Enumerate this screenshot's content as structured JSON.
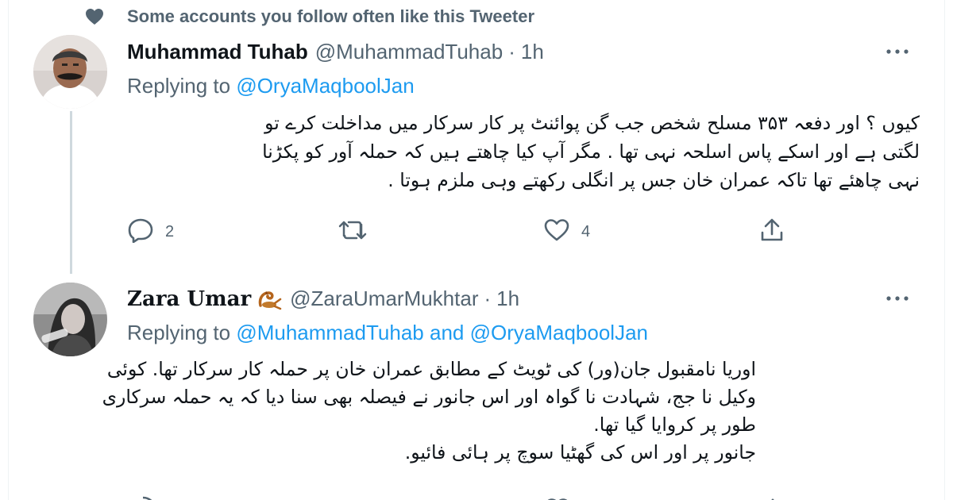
{
  "social_context": {
    "text": "Some accounts you follow often like this Tweeter",
    "icon": "heart-icon"
  },
  "tweets": [
    {
      "display_name": "Muhammad Tuhab",
      "handle": "@MuhammadTuhab",
      "separator": "·",
      "time": "1h",
      "replying_prefix": "Replying to",
      "mention_1": "@OryaMaqboolJan",
      "mention_joiner": "",
      "mention_2": "",
      "body_lines": [
        "کیوں ؟ اور دفعہ ۳۵۳ مسلح شخص جب گن پوائنٹ پر کار سرکار میں مداخلت کرے تو",
        "لگتی ہے اور اسکے پاس اسلحہ نہی تھا . مگر آپ کیا چاھتے ہیں کہ حملہ آور کو پکڑنا",
        "نہی چاھئے تھا تاکہ عمران خان جس پر انگلی رکھتے وہی ملزم ہوتا ."
      ],
      "reply_count": "2",
      "retweet_count": "",
      "like_count": "4"
    },
    {
      "display_name": "𝐙𝐚𝐫𝐚 𝐔𝐦𝐚𝐫",
      "handle": "@ZaraUmarMukhtar",
      "separator": "·",
      "time": "1h",
      "replying_prefix": "Replying to",
      "mention_1": "@MuhammadTuhab",
      "mention_joiner": "and",
      "mention_2": "@OryaMaqboolJan",
      "body_lines": [
        "اوریا نامقبول جان(ور) کی ٹویٹ کے مطابق عمران خان پر حملہ کار سرکار تھا. کوئی",
        "وکیل نا جج،  شہادت نا گواہ اور اس جانور نے فیصلہ بھی سنا دیا کہ یہ حملہ سرکاری",
        "طور پر کروایا گیا تھا.",
        "جانور پر اور اس کی گھٹیا سوچ پر ہائی فائیو."
      ]
    }
  ],
  "icons": {
    "more": "more-icon",
    "reply": "reply-icon",
    "retweet": "retweet-icon",
    "like": "like-icon",
    "share": "share-icon",
    "scorpion": "scorpion-emoji-icon"
  },
  "colors": {
    "accent": "#1d9bf0",
    "secondary_text": "#536471",
    "primary_text": "#0f1419",
    "thread_line": "#cfd9de"
  }
}
